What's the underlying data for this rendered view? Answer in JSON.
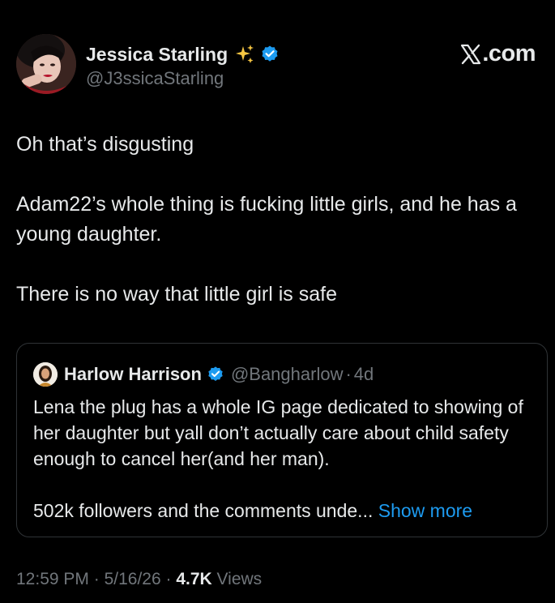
{
  "colors": {
    "background": "#000000",
    "text_primary": "#e7e9ea",
    "text_secondary": "#71767b",
    "link": "#1d9bf0",
    "verified": "#1d9bf0",
    "border": "#2f3336"
  },
  "brand": {
    "label": ".com",
    "icon": "x-logo-icon"
  },
  "author": {
    "display_name": "Jessica Starling",
    "emoji_icon": "sparkles-icon",
    "verified_icon": "verified-badge-icon",
    "handle": "@J3ssicaStarling"
  },
  "post": {
    "paragraphs": [
      "Oh that’s disgusting",
      "Adam22’s whole thing is fucking little girls, and he has a young daughter.",
      "There is no way that little girl is safe"
    ]
  },
  "quoted_post": {
    "display_name": "Harlow Harrison",
    "verified_icon": "verified-badge-icon",
    "handle": "@Bangharlow",
    "separator": "·",
    "age": "4d",
    "paragraph_1": "Lena the plug has a whole IG page dedicated to showing of her daughter but yall don’t actually care about child safety enough to cancel her(and her man).",
    "paragraph_2": "502k followers and the comments unde...",
    "show_more": "Show more"
  },
  "meta": {
    "time": "12:59 PM",
    "separator": "·",
    "date": "5/16/26",
    "views_count": "4.7K",
    "views_label": "Views"
  }
}
